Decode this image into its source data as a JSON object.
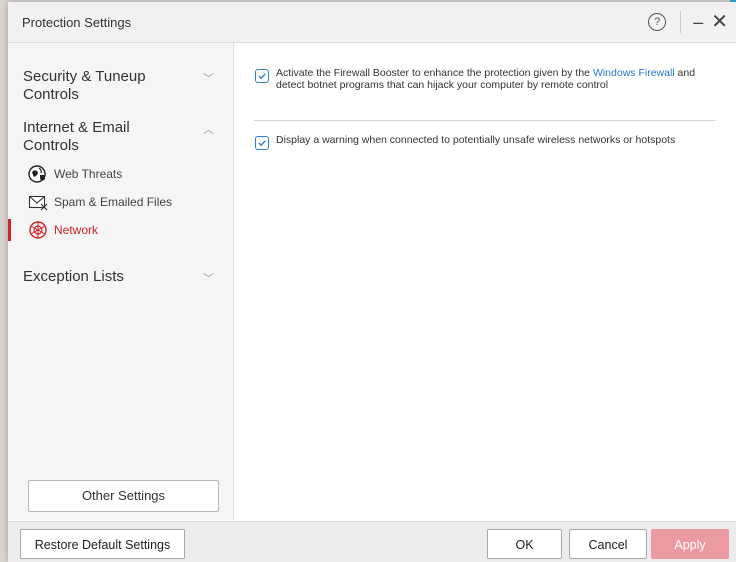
{
  "window": {
    "title": "Protection Settings"
  },
  "titlebar": {
    "help_symbol": "?",
    "minimize_symbol": "–",
    "close_symbol": "✕"
  },
  "sidebar": {
    "groups": [
      {
        "label": "Security & Tuneup Controls",
        "expanded": false
      },
      {
        "label": "Internet & Email Controls",
        "expanded": true,
        "items": [
          {
            "label": "Web Threats",
            "icon": "globe-shield-icon"
          },
          {
            "label": "Spam & Emailed Files",
            "icon": "mail-x-icon"
          },
          {
            "label": "Network",
            "icon": "network-globe-icon",
            "active": true
          }
        ]
      },
      {
        "label": "Exception Lists",
        "expanded": false
      }
    ],
    "other_settings_label": "Other Settings"
  },
  "content": {
    "options": [
      {
        "checked": true,
        "text_before": "Activate the Firewall Booster to enhance the protection given by the ",
        "link": "Windows Firewall",
        "text_after": " and detect botnet programs that can hijack your computer by remote control"
      },
      {
        "checked": true,
        "text": "Display a warning when connected to potentially unsafe wireless networks or hotspots"
      }
    ]
  },
  "footer": {
    "restore_label": "Restore Default Settings",
    "ok_label": "OK",
    "cancel_label": "Cancel",
    "apply_label": "Apply"
  },
  "colors": {
    "accent_red": "#d0242b",
    "link_blue": "#2878d4",
    "apply_disabled": "#ea9aa0",
    "sidebar_bg": "#f5f5f5"
  }
}
